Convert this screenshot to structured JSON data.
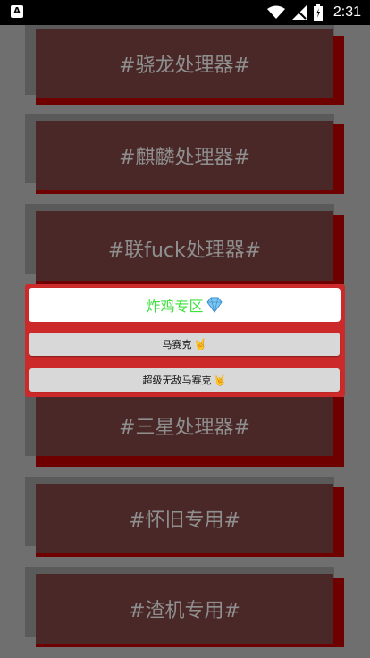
{
  "status_bar": {
    "time": "2:31",
    "left_icon": "A"
  },
  "cards": [
    {
      "label": "#骁龙处理器#"
    },
    {
      "label": "#麒麟处理器#"
    },
    {
      "label": "#联fuck处理器#"
    },
    {
      "label": "#三星处理器#"
    },
    {
      "label": "#怀旧专用#"
    },
    {
      "label": "#渣机专用#"
    }
  ],
  "dialog": {
    "title": "炸鸡专区",
    "title_color": "#3ee23e",
    "buttons": [
      {
        "label": "马赛克"
      },
      {
        "label": "超级无敌马赛克"
      }
    ],
    "background_color": "#cc2a2a"
  }
}
